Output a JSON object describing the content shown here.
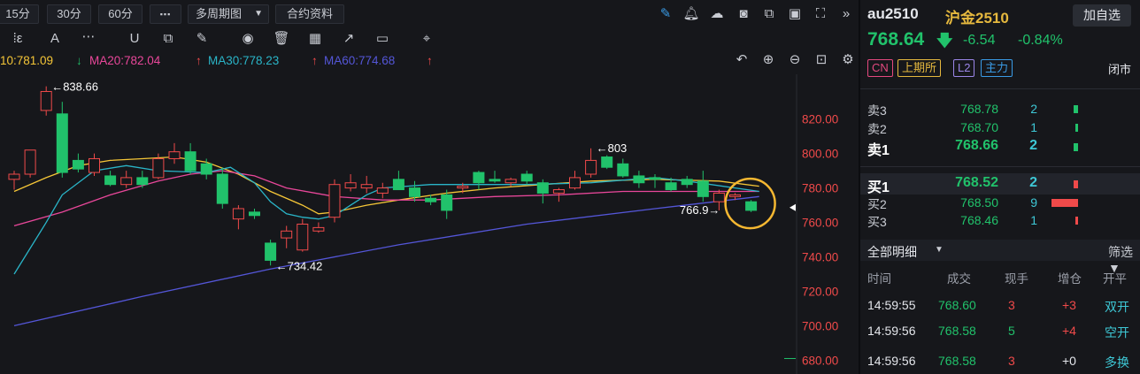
{
  "toolbar": {
    "timeframes": [
      "15分",
      "30分",
      "60分"
    ],
    "more": "▪▪▪",
    "multi_period": "多周期图",
    "contract_info": "合约资料"
  },
  "ma_legend": {
    "ma10": "10:781.09",
    "ma20": "MA20:782.04",
    "ma30": "MA30:778.23",
    "ma60": "MA60:774.68",
    "colors": {
      "ma10": "#f5c637",
      "ma20": "#e9479a",
      "ma30": "#2ab5c8",
      "ma60": "#5456d8"
    }
  },
  "chart_data": {
    "type": "candlestick",
    "y_ticks": [
      "820.00",
      "800.00",
      "780.00",
      "760.00",
      "740.00",
      "720.00",
      "700.00",
      "680.00"
    ],
    "ylim": [
      672,
      846
    ],
    "annotations": {
      "high": "←838.66",
      "low": "←734.42",
      "mid_high": "←803",
      "last_low": "766.9→"
    },
    "up_color": "#f04a4a",
    "down_color": "#21c26b",
    "candles": [
      {
        "o": 785,
        "h": 790,
        "l": 779,
        "c": 788
      },
      {
        "o": 788,
        "h": 795,
        "l": 786,
        "c": 802
      },
      {
        "o": 825,
        "h": 839,
        "l": 822,
        "c": 836
      },
      {
        "o": 823,
        "h": 830,
        "l": 786,
        "c": 789
      },
      {
        "o": 796,
        "h": 800,
        "l": 789,
        "c": 791
      },
      {
        "o": 789,
        "h": 800,
        "l": 787,
        "c": 797
      },
      {
        "o": 787,
        "h": 790,
        "l": 781,
        "c": 782
      },
      {
        "o": 782,
        "h": 790,
        "l": 780,
        "c": 786
      },
      {
        "o": 786,
        "h": 790,
        "l": 780,
        "c": 782
      },
      {
        "o": 786,
        "h": 800,
        "l": 785,
        "c": 797
      },
      {
        "o": 797,
        "h": 806,
        "l": 794,
        "c": 801
      },
      {
        "o": 801,
        "h": 806,
        "l": 788,
        "c": 790
      },
      {
        "o": 794,
        "h": 797,
        "l": 785,
        "c": 788
      },
      {
        "o": 788,
        "h": 792,
        "l": 768,
        "c": 771
      },
      {
        "o": 762,
        "h": 770,
        "l": 756,
        "c": 768
      },
      {
        "o": 766,
        "h": 768,
        "l": 762,
        "c": 764
      },
      {
        "o": 748,
        "h": 750,
        "l": 735,
        "c": 738
      },
      {
        "o": 751,
        "h": 758,
        "l": 745,
        "c": 755
      },
      {
        "o": 744,
        "h": 762,
        "l": 743,
        "c": 759
      },
      {
        "o": 755,
        "h": 760,
        "l": 754,
        "c": 757
      },
      {
        "o": 763,
        "h": 785,
        "l": 760,
        "c": 782
      },
      {
        "o": 780,
        "h": 788,
        "l": 778,
        "c": 783
      },
      {
        "o": 780,
        "h": 787,
        "l": 777,
        "c": 782
      },
      {
        "o": 777,
        "h": 783,
        "l": 774,
        "c": 780
      },
      {
        "o": 785,
        "h": 790,
        "l": 779,
        "c": 779
      },
      {
        "o": 780,
        "h": 784,
        "l": 772,
        "c": 775
      },
      {
        "o": 774,
        "h": 776,
        "l": 770,
        "c": 772
      },
      {
        "o": 776,
        "h": 779,
        "l": 762,
        "c": 767
      },
      {
        "o": 780,
        "h": 783,
        "l": 777,
        "c": 781
      },
      {
        "o": 789,
        "h": 790,
        "l": 779,
        "c": 783
      },
      {
        "o": 785,
        "h": 790,
        "l": 783,
        "c": 784
      },
      {
        "o": 783,
        "h": 786,
        "l": 781,
        "c": 785
      },
      {
        "o": 788,
        "h": 790,
        "l": 782,
        "c": 784
      },
      {
        "o": 783,
        "h": 785,
        "l": 771,
        "c": 777
      },
      {
        "o": 777,
        "h": 780,
        "l": 772,
        "c": 779
      },
      {
        "o": 780,
        "h": 790,
        "l": 779,
        "c": 786
      },
      {
        "o": 788,
        "h": 803,
        "l": 786,
        "c": 796
      },
      {
        "o": 798,
        "h": 799,
        "l": 791,
        "c": 792
      },
      {
        "o": 794,
        "h": 797,
        "l": 786,
        "c": 787
      },
      {
        "o": 787,
        "h": 790,
        "l": 780,
        "c": 783
      },
      {
        "o": 786,
        "h": 788,
        "l": 780,
        "c": 785
      },
      {
        "o": 783,
        "h": 786,
        "l": 778,
        "c": 779
      },
      {
        "o": 785,
        "h": 787,
        "l": 780,
        "c": 782
      },
      {
        "o": 784,
        "h": 790,
        "l": 772,
        "c": 775
      },
      {
        "o": 772,
        "h": 779,
        "l": 767,
        "c": 777
      },
      {
        "o": 775,
        "h": 777,
        "l": 773,
        "c": 776
      },
      {
        "o": 772,
        "h": 773,
        "l": 766,
        "c": 767
      }
    ],
    "ma_series": [
      {
        "name": "MA10",
        "color": "#f5c637",
        "points": [
          [
            0,
            778
          ],
          [
            2,
            786
          ],
          [
            4,
            793
          ],
          [
            6,
            796
          ],
          [
            8,
            797
          ],
          [
            10,
            798
          ],
          [
            12,
            795
          ],
          [
            14,
            788
          ],
          [
            16,
            778
          ],
          [
            18,
            770
          ],
          [
            19,
            765
          ],
          [
            20,
            766
          ],
          [
            22,
            770
          ],
          [
            24,
            773
          ],
          [
            27,
            777
          ],
          [
            30,
            780
          ],
          [
            33,
            782
          ],
          [
            36,
            784
          ],
          [
            40,
            785
          ],
          [
            44,
            784
          ],
          [
            46.5,
            781
          ]
        ]
      },
      {
        "name": "MA20",
        "color": "#e9479a",
        "points": [
          [
            0,
            758
          ],
          [
            3,
            766
          ],
          [
            6,
            776
          ],
          [
            9,
            784
          ],
          [
            11,
            788
          ],
          [
            13,
            790
          ],
          [
            15,
            787
          ],
          [
            17,
            780
          ],
          [
            20,
            775
          ],
          [
            23,
            773
          ],
          [
            26,
            773
          ],
          [
            30,
            775
          ],
          [
            34,
            776
          ],
          [
            38,
            778
          ],
          [
            42,
            778
          ],
          [
            46.5,
            778
          ]
        ]
      },
      {
        "name": "MA30",
        "color": "#2ab5c8",
        "points": [
          [
            0,
            730
          ],
          [
            2,
            760
          ],
          [
            3,
            776
          ],
          [
            5,
            790
          ],
          [
            7,
            793
          ],
          [
            9,
            790
          ],
          [
            12,
            789
          ],
          [
            13.5,
            792
          ],
          [
            15,
            783
          ],
          [
            16,
            772
          ],
          [
            17,
            765
          ],
          [
            18,
            763
          ],
          [
            19,
            762
          ],
          [
            20,
            764
          ],
          [
            21,
            770
          ],
          [
            22,
            776
          ],
          [
            23,
            780
          ],
          [
            26,
            782
          ],
          [
            32,
            782
          ],
          [
            36,
            783
          ],
          [
            40,
            786
          ],
          [
            42,
            784
          ],
          [
            46.5,
            778
          ]
        ]
      },
      {
        "name": "MA60",
        "color": "#5456d8",
        "points": [
          [
            0,
            700
          ],
          [
            8,
            717
          ],
          [
            16,
            733
          ],
          [
            24,
            747
          ],
          [
            32,
            759
          ],
          [
            40,
            768
          ],
          [
            46.5,
            775
          ]
        ]
      }
    ]
  },
  "quote": {
    "symbol": "au2510",
    "name": "沪金2510",
    "add_watch": "加自选",
    "price": "768.64",
    "change": "-6.54",
    "change_pct": "-0.84%",
    "tags": [
      "CN",
      "上期所",
      "L2",
      "主力"
    ],
    "status": "闭市"
  },
  "orderbook": {
    "asks": [
      {
        "label": "卖3",
        "price": "768.78",
        "vol": "2",
        "bar": 0.05
      },
      {
        "label": "卖2",
        "price": "768.70",
        "vol": "1",
        "bar": 0.03
      },
      {
        "label": "卖1",
        "price": "768.66",
        "vol": "2",
        "bar": 0.05
      }
    ],
    "bids": [
      {
        "label": "买1",
        "price": "768.52",
        "vol": "2",
        "bar": 0.05
      },
      {
        "label": "买2",
        "price": "768.50",
        "vol": "9",
        "bar": 0.9
      },
      {
        "label": "买3",
        "price": "768.46",
        "vol": "1",
        "bar": 0.03
      }
    ]
  },
  "details": {
    "title": "全部明细",
    "filter": "筛选",
    "columns": [
      "时间",
      "成交",
      "现手",
      "增仓",
      "开平"
    ],
    "rows": [
      {
        "time": "14:59:55",
        "price": "768.60",
        "qty": "3",
        "oi": "+3",
        "type": "双开"
      },
      {
        "time": "14:59:56",
        "price": "768.58",
        "qty": "5",
        "oi": "+4",
        "type": "空开"
      },
      {
        "time": "14:59:56",
        "price": "768.58",
        "qty": "3",
        "oi": "+0",
        "type": "多换"
      }
    ]
  }
}
